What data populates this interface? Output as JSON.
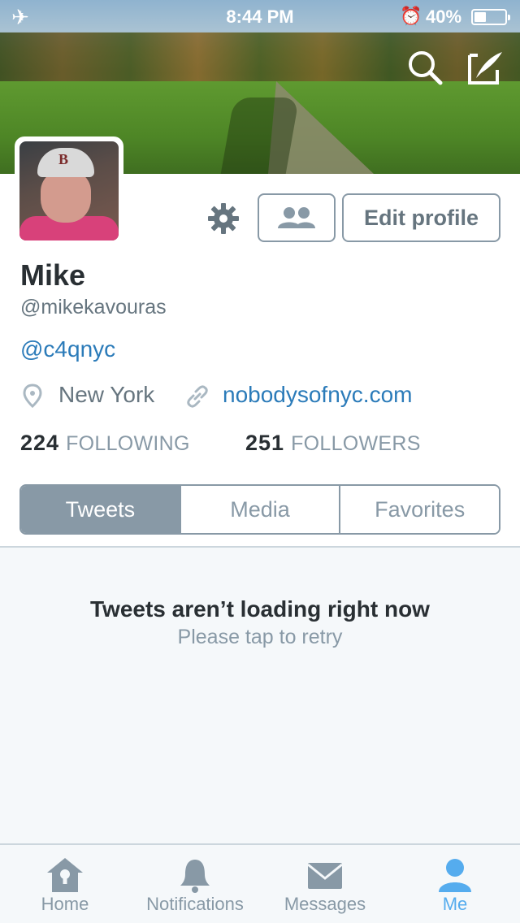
{
  "status_bar": {
    "time": "8:44 PM",
    "battery_percent": "40%",
    "battery_level": 0.4,
    "icons": [
      "airplane-icon",
      "alarm-icon",
      "battery-icon"
    ]
  },
  "header": {
    "search_icon": "search-icon",
    "compose_icon": "compose-tweet-icon"
  },
  "profile": {
    "name": "Mike",
    "handle": "@mikekavouras",
    "bio_link": "@c4qnyc",
    "location": "New York",
    "website": "nobodysofnyc.com",
    "following_count": "224",
    "following_label": "FOLLOWING",
    "followers_count": "251",
    "followers_label": "FOLLOWERS"
  },
  "actions": {
    "settings_icon": "gear-icon",
    "people_icon": "people-icon",
    "edit_profile_label": "Edit profile"
  },
  "tabs": [
    {
      "label": "Tweets",
      "active": true
    },
    {
      "label": "Media",
      "active": false
    },
    {
      "label": "Favorites",
      "active": false
    }
  ],
  "timeline": {
    "error_title": "Tweets aren’t loading right now",
    "error_subtitle": "Please tap to retry"
  },
  "tab_bar": [
    {
      "label": "Home",
      "icon": "home-icon",
      "active": false
    },
    {
      "label": "Notifications",
      "icon": "bell-icon",
      "active": false
    },
    {
      "label": "Messages",
      "icon": "envelope-icon",
      "active": false
    },
    {
      "label": "Me",
      "icon": "person-icon",
      "active": true
    }
  ],
  "colors": {
    "accent": "#55acee",
    "link": "#2b7bb9",
    "muted": "#8899a6",
    "text": "#292f33",
    "timeline_bg": "#f5f8fa"
  }
}
